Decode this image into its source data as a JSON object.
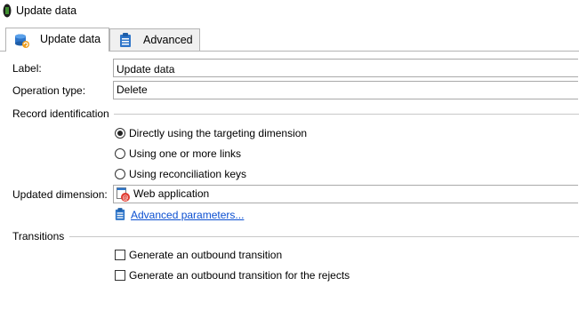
{
  "window": {
    "title": "Update data"
  },
  "tabs": [
    {
      "label": "Update data",
      "icon": "database-update-icon",
      "active": true
    },
    {
      "label": "Advanced",
      "icon": "clipboard-icon",
      "active": false
    }
  ],
  "form": {
    "label_caption": "Label:",
    "label_value": "Update data",
    "operation_caption": "Operation type:",
    "operation_value": "Delete"
  },
  "record_identification": {
    "title": "Record identification",
    "options": [
      {
        "label": "Directly using the targeting dimension",
        "selected": true
      },
      {
        "label": "Using one or more links",
        "selected": false
      },
      {
        "label": "Using reconciliation keys",
        "selected": false
      }
    ]
  },
  "updated_dimension": {
    "caption": "Updated dimension:",
    "value": "Web application",
    "icon": "web-application-icon"
  },
  "advanced_parameters": {
    "label": "Advanced parameters...",
    "icon": "clipboard-icon"
  },
  "transitions": {
    "title": "Transitions",
    "options": [
      {
        "label": "Generate an outbound transition",
        "checked": false
      },
      {
        "label": "Generate an outbound transition for the rejects",
        "checked": false
      }
    ]
  },
  "colors": {
    "link": "#0b4fd1",
    "border": "#b4b4b4",
    "tab_inactive": "#f0f0f0"
  }
}
